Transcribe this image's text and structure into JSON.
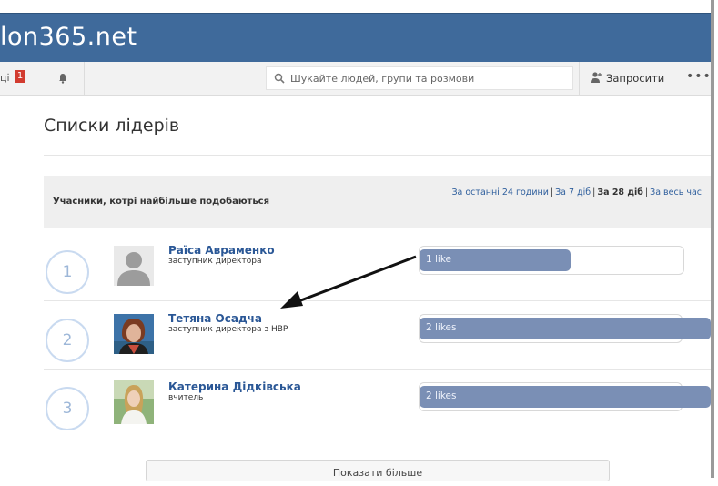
{
  "header": {
    "brand": "lon365.net"
  },
  "toolbar": {
    "partial_label": "ці",
    "badge_count": "1",
    "search_placeholder": "Шукайте людей, групи та розмови",
    "invite_label": "Запросити",
    "more_label": "•••"
  },
  "page": {
    "title": "Списки лідерів",
    "section_label": "Учасники, котрі найбільше подобаються",
    "filters": [
      "За останні 24 години",
      "За 7 діб",
      "За 28 діб",
      "За весь час"
    ]
  },
  "leaders": [
    {
      "rank": "1",
      "name": "Раїса Авраменко",
      "role": "заступник директора",
      "likes_label": "1 like",
      "likes": 1
    },
    {
      "rank": "2",
      "name": "Тетяна Осадча",
      "role": "заступник директора з НВР",
      "likes_label": "2 likes",
      "likes": 2
    },
    {
      "rank": "3",
      "name": "Катерина Дідківська",
      "role": "вчитель",
      "likes_label": "2 likes",
      "likes": 2
    }
  ],
  "show_more_label": "Показати більше",
  "colors": {
    "brand_bar": "#3f6a9b",
    "link": "#2a5796",
    "bar_fill": "#7a8fb5",
    "badge": "#d23b2f"
  }
}
